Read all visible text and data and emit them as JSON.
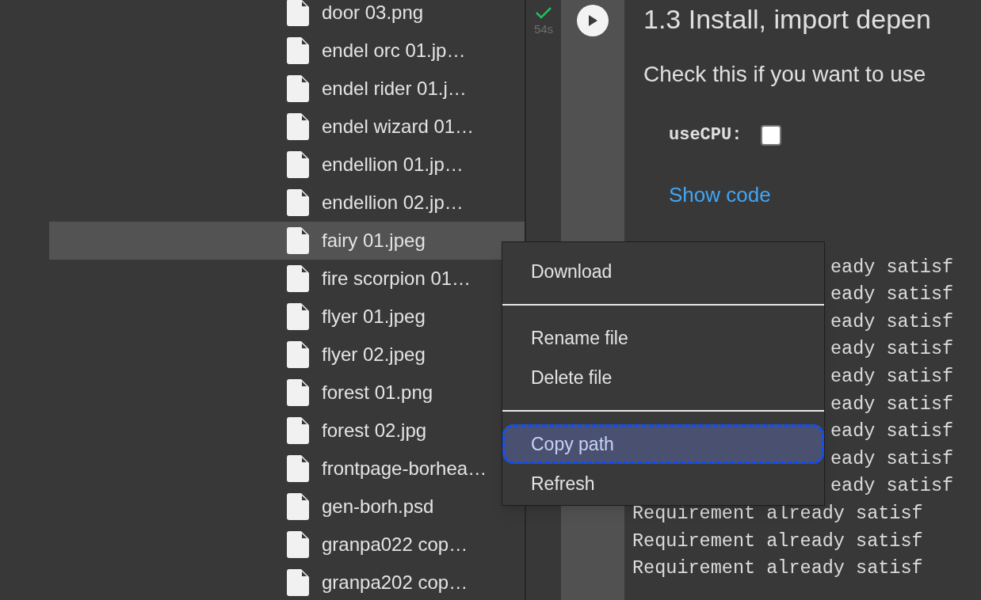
{
  "files": [
    {
      "name": "door 03.png",
      "selected": false
    },
    {
      "name": "endel orc 01.jp…",
      "selected": false
    },
    {
      "name": "endel rider 01.j…",
      "selected": false
    },
    {
      "name": "endel wizard 01…",
      "selected": false
    },
    {
      "name": "endellion 01.jp…",
      "selected": false
    },
    {
      "name": "endellion 02.jp…",
      "selected": false
    },
    {
      "name": "fairy 01.jpeg",
      "selected": true
    },
    {
      "name": "fire scorpion 01…",
      "selected": false
    },
    {
      "name": "flyer 01.jpeg",
      "selected": false
    },
    {
      "name": "flyer 02.jpeg",
      "selected": false
    },
    {
      "name": "forest 01.png",
      "selected": false
    },
    {
      "name": "forest 02.jpg",
      "selected": false
    },
    {
      "name": "frontpage-borhea…",
      "selected": false
    },
    {
      "name": "gen-borh.psd",
      "selected": false
    },
    {
      "name": "granpa022 cop…",
      "selected": false
    },
    {
      "name": "granpa202 cop…",
      "selected": false
    }
  ],
  "cell": {
    "time": "54s",
    "heading": "1.3 Install, import depen",
    "description": "Check this if you want to use",
    "param": {
      "label": "useCPU:",
      "checked": false
    },
    "show_code": "Show code",
    "output": [
      {
        "kind": "partial",
        "text": "eady satisf"
      },
      {
        "kind": "partial",
        "text": "eady satisf"
      },
      {
        "kind": "partial",
        "text": "eady satisf"
      },
      {
        "kind": "partial",
        "text": "eady satisf"
      },
      {
        "kind": "partial",
        "text": "eady satisf"
      },
      {
        "kind": "partial",
        "text": "eady satisf"
      },
      {
        "kind": "partial",
        "text": "eady satisf"
      },
      {
        "kind": "partial",
        "text": "eady satisf"
      },
      {
        "kind": "partial",
        "text": "eady satisf"
      },
      {
        "kind": "full",
        "text": "Requirement already satisf"
      },
      {
        "kind": "full",
        "text": "Requirement already satisf"
      },
      {
        "kind": "full",
        "text": "Requirement already satisf"
      }
    ]
  },
  "context_menu": {
    "items": [
      {
        "kind": "item",
        "label": "Download",
        "selected": false
      },
      {
        "kind": "divider"
      },
      {
        "kind": "item",
        "label": "Rename file",
        "selected": false
      },
      {
        "kind": "item",
        "label": "Delete file",
        "selected": false
      },
      {
        "kind": "divider"
      },
      {
        "kind": "item",
        "label": "Copy path",
        "selected": true
      },
      {
        "kind": "item",
        "label": "Refresh",
        "selected": false
      }
    ]
  }
}
